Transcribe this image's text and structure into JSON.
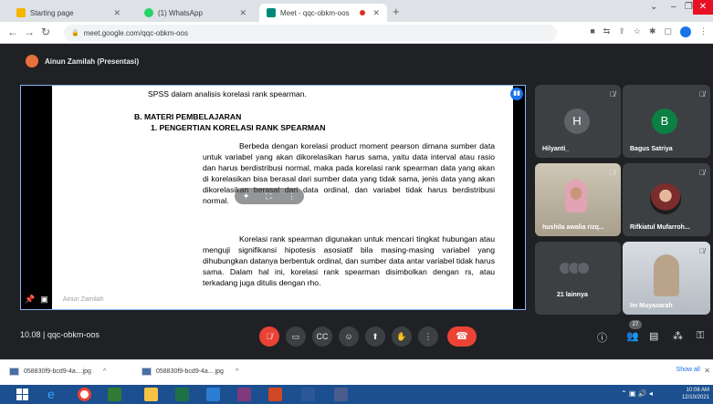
{
  "browser": {
    "tabs": [
      {
        "title": "Starting page",
        "color": "#f4b400"
      },
      {
        "title": "(1) WhatsApp",
        "color": "#25d366"
      },
      {
        "title": "Meet - qqc-obkm-oos",
        "color": "#00897b"
      }
    ],
    "url": "meet.google.com/qqc-obkm-oos"
  },
  "meet": {
    "presenter_label": "Ainun Zamilah (Presentasi)",
    "presenter_watermark": "Ainun Zamilah",
    "meeting_info": "10.08 | qqc-obkm-oos",
    "people_count": "27"
  },
  "document": {
    "line1": "SPSS dalam analisis korelasi rank spearman.",
    "heading1": "B. MATERI PEMBELAJARAN",
    "heading2": "1.  PENGERTIAN KORELASI RANK SPEARMAN",
    "para1": "Berbeda dengan korelasi product moment pearson dimana sumber data untuk variabel yang akan dikorelasikan harus sama, yaitu data interval atau rasio dan harus berdistribusi normal, maka pada korelasi rank spearman data yang akan di korelasikan bisa berasal dari sumber data yang tidak sama, jenis data yang akan dikorelasikan berasal dari data ordinal, dan variabel tidak harus berdistribusi normal.",
    "para2": "Korelasi rank spearman digunakan untuk mencari tingkat hubungan atau menguji signifikansi hipotesis asosiatif bila masing-masing  variabel yang dihubungkan datanya berbentuk ordinal, dan sumber data antar variabel tidak harus sama. Dalam hal ini, korelasi rank spearman disimbolkan dengan rs, atau terkadang juga ditulis dengan rho."
  },
  "participants": [
    {
      "name": "Hilyanti_",
      "initial": "H",
      "color": "#5f6368"
    },
    {
      "name": "Bagus Satriya",
      "initial": "B",
      "color": "#0b8043"
    },
    {
      "name": "hushila awalia rizq...",
      "initial": "",
      "color": ""
    },
    {
      "name": "Rifkiatul Mufarroh...",
      "initial": "",
      "color": ""
    },
    {
      "name": "21 lainnya",
      "initial": "",
      "color": ""
    },
    {
      "name": "Iin Muyasarah",
      "initial": "",
      "color": ""
    }
  ],
  "downloads": {
    "items": [
      "058830f9-bcd9-4a....jpg",
      "058830f9-bcd9-4a....jpg"
    ],
    "show_all": "Show all"
  },
  "taskbar": {
    "time": "10:08 AM",
    "date": "12/10/2021"
  }
}
